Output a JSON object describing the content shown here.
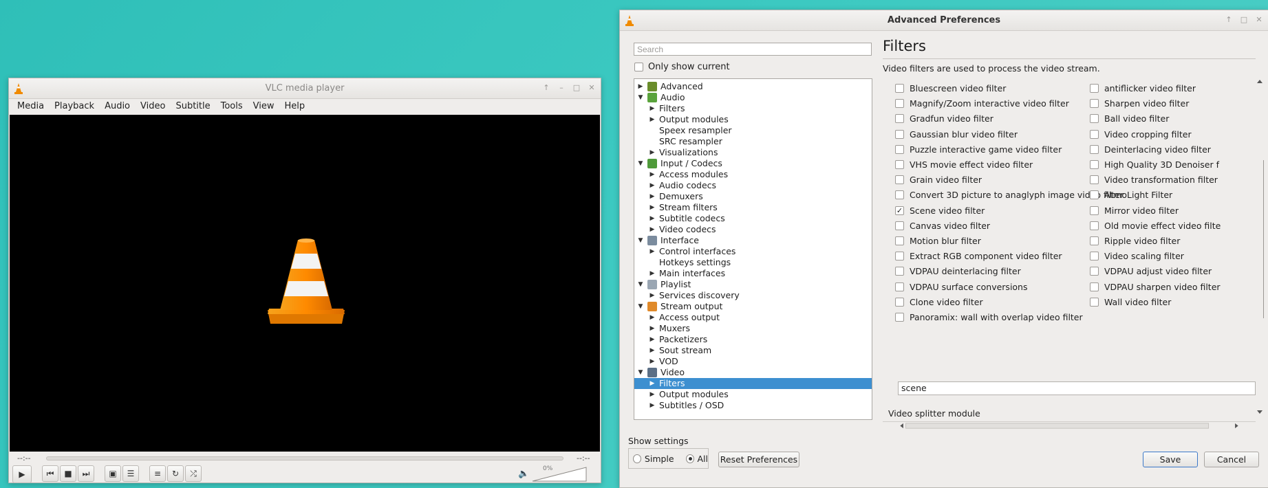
{
  "vlc": {
    "title": "VLC media player",
    "menu": [
      "Media",
      "Playback",
      "Audio",
      "Video",
      "Subtitle",
      "Tools",
      "View",
      "Help"
    ],
    "time_elapsed": "--:--",
    "time_total": "--:--",
    "volume": "0%"
  },
  "prefs": {
    "title": "Advanced Preferences",
    "search_placeholder": "Search",
    "only_show_current": "Only show current",
    "tree": [
      {
        "label": "Advanced",
        "level": 0,
        "arrow": "right",
        "icon": "advanced-icon",
        "color": "#6a8d2b"
      },
      {
        "label": "Audio",
        "level": 0,
        "arrow": "down",
        "icon": "audio-icon",
        "color": "#5aa33c"
      },
      {
        "label": "Filters",
        "level": 1,
        "arrow": "right"
      },
      {
        "label": "Output modules",
        "level": 1,
        "arrow": "right"
      },
      {
        "label": "Speex resampler",
        "level": 1,
        "arrow": ""
      },
      {
        "label": "SRC resampler",
        "level": 1,
        "arrow": ""
      },
      {
        "label": "Visualizations",
        "level": 1,
        "arrow": "right"
      },
      {
        "label": "Input / Codecs",
        "level": 0,
        "arrow": "down",
        "icon": "codecs-icon",
        "color": "#4f9a3a"
      },
      {
        "label": "Access modules",
        "level": 1,
        "arrow": "right"
      },
      {
        "label": "Audio codecs",
        "level": 1,
        "arrow": "right"
      },
      {
        "label": "Demuxers",
        "level": 1,
        "arrow": "right"
      },
      {
        "label": "Stream filters",
        "level": 1,
        "arrow": "right"
      },
      {
        "label": "Subtitle codecs",
        "level": 1,
        "arrow": "right"
      },
      {
        "label": "Video codecs",
        "level": 1,
        "arrow": "right"
      },
      {
        "label": "Interface",
        "level": 0,
        "arrow": "down",
        "icon": "interface-icon",
        "color": "#7b8c9e"
      },
      {
        "label": "Control interfaces",
        "level": 1,
        "arrow": "right"
      },
      {
        "label": "Hotkeys settings",
        "level": 1,
        "arrow": ""
      },
      {
        "label": "Main interfaces",
        "level": 1,
        "arrow": "right"
      },
      {
        "label": "Playlist",
        "level": 0,
        "arrow": "down",
        "icon": "playlist-icon",
        "color": "#9aa6b3"
      },
      {
        "label": "Services discovery",
        "level": 1,
        "arrow": "right"
      },
      {
        "label": "Stream output",
        "level": 0,
        "arrow": "down",
        "icon": "stream-output-icon",
        "color": "#e08a2a"
      },
      {
        "label": "Access output",
        "level": 1,
        "arrow": "right"
      },
      {
        "label": "Muxers",
        "level": 1,
        "arrow": "right"
      },
      {
        "label": "Packetizers",
        "level": 1,
        "arrow": "right"
      },
      {
        "label": "Sout stream",
        "level": 1,
        "arrow": "right"
      },
      {
        "label": "VOD",
        "level": 1,
        "arrow": "right"
      },
      {
        "label": "Video",
        "level": 0,
        "arrow": "down",
        "icon": "video-icon",
        "color": "#5b6f86"
      },
      {
        "label": "Filters",
        "level": 1,
        "arrow": "right",
        "selected": true
      },
      {
        "label": "Output modules",
        "level": 1,
        "arrow": "right"
      },
      {
        "label": "Subtitles / OSD",
        "level": 1,
        "arrow": "right"
      }
    ],
    "panel_title": "Filters",
    "panel_desc": "Video filters are used to process the video stream.",
    "filters_left": [
      {
        "label": "Bluescreen video filter",
        "checked": false
      },
      {
        "label": "Magnify/Zoom interactive video filter",
        "checked": false
      },
      {
        "label": "Gradfun video filter",
        "checked": false
      },
      {
        "label": "Gaussian blur video filter",
        "checked": false
      },
      {
        "label": "Puzzle interactive game video filter",
        "checked": false
      },
      {
        "label": "VHS movie effect video filter",
        "checked": false
      },
      {
        "label": "Grain video filter",
        "checked": false
      },
      {
        "label": "Convert 3D picture to anaglyph image video filter",
        "checked": false
      },
      {
        "label": "Scene video filter",
        "checked": true
      },
      {
        "label": "Canvas video filter",
        "checked": false
      },
      {
        "label": "Motion blur filter",
        "checked": false
      },
      {
        "label": "Extract RGB component video filter",
        "checked": false
      },
      {
        "label": "VDPAU deinterlacing filter",
        "checked": false
      },
      {
        "label": "VDPAU surface conversions",
        "checked": false
      },
      {
        "label": "Clone video filter",
        "checked": false
      },
      {
        "label": "Panoramix: wall with overlap video filter",
        "checked": false
      }
    ],
    "filters_right": [
      {
        "label": "antiflicker video filter",
        "checked": false
      },
      {
        "label": "Sharpen video filter",
        "checked": false
      },
      {
        "label": "Ball video filter",
        "checked": false
      },
      {
        "label": "Video cropping filter",
        "checked": false
      },
      {
        "label": "Deinterlacing video filter",
        "checked": false
      },
      {
        "label": "High Quality 3D Denoiser f",
        "checked": false
      },
      {
        "label": "Video transformation filter",
        "checked": false
      },
      {
        "label": "AtmoLight Filter",
        "checked": false
      },
      {
        "label": "Mirror video filter",
        "checked": false
      },
      {
        "label": "Old movie effect video filte",
        "checked": false
      },
      {
        "label": "Ripple video filter",
        "checked": false
      },
      {
        "label": "Video scaling filter",
        "checked": false
      },
      {
        "label": "VDPAU adjust video filter",
        "checked": false
      },
      {
        "label": "VDPAU sharpen video filter",
        "checked": false
      },
      {
        "label": "Wall video filter",
        "checked": false
      }
    ],
    "filter_value": "scene",
    "splitter_label": "Video splitter module",
    "show_settings": "Show settings",
    "simple": "Simple",
    "all": "All",
    "reset": "Reset Preferences",
    "save": "Save",
    "cancel": "Cancel"
  }
}
